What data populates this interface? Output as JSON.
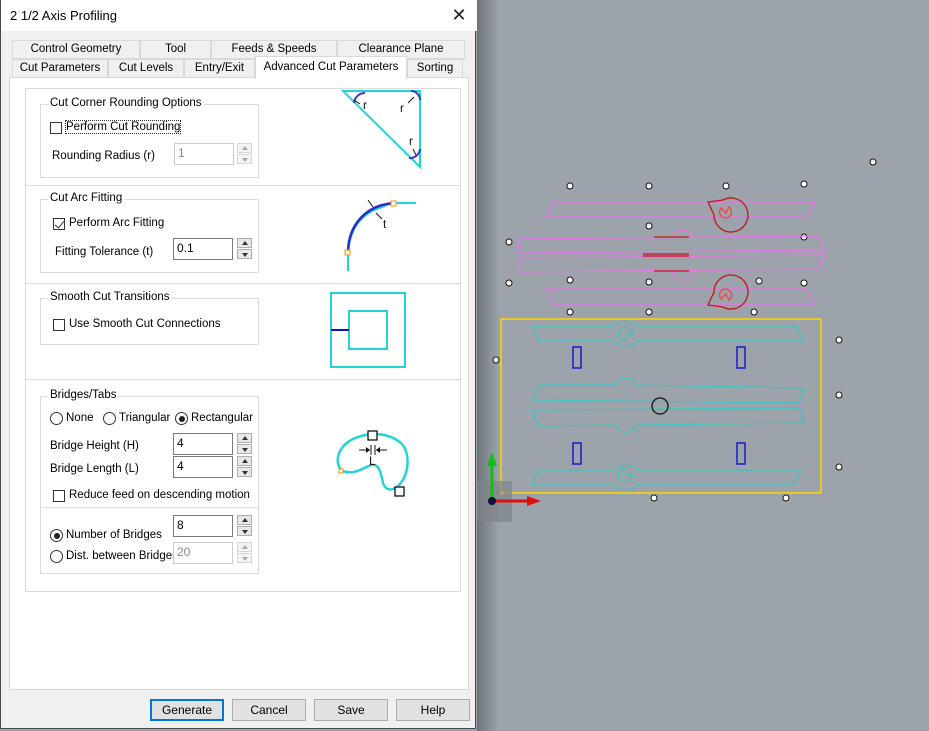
{
  "dialog": {
    "title": "2 1/2 Axis Profiling",
    "close_icon": "close-icon",
    "tabs_row1": [
      {
        "label": "Control Geometry"
      },
      {
        "label": "Tool"
      },
      {
        "label": "Feeds & Speeds"
      },
      {
        "label": "Clearance Plane"
      }
    ],
    "tabs_row2": [
      {
        "label": "Cut Parameters"
      },
      {
        "label": "Cut Levels"
      },
      {
        "label": "Entry/Exit"
      },
      {
        "label": "Advanced Cut Parameters",
        "active": true
      },
      {
        "label": "Sorting"
      }
    ],
    "corner_rounding": {
      "title": "Cut Corner Rounding Options",
      "perform_label": "Perform Cut Rounding",
      "perform_checked": false,
      "radius_label": "Rounding Radius (r)",
      "radius_value": "1",
      "radius_disabled": true,
      "illus_label": "r"
    },
    "arc_fitting": {
      "title": "Cut Arc Fitting",
      "perform_label": "Perform Arc Fitting",
      "perform_checked": true,
      "tolerance_label": "Fitting Tolerance (t)",
      "tolerance_value": "0.1",
      "illus_label": "t"
    },
    "smooth_transitions": {
      "title": "Smooth Cut Transitions",
      "use_label": "Use Smooth Cut Connections",
      "use_checked": false
    },
    "bridges": {
      "title": "Bridges/Tabs",
      "type_options": [
        "None",
        "Triangular",
        "Rectangular"
      ],
      "type_selected": "Rectangular",
      "height_label": "Bridge Height (H)",
      "height_value": "4",
      "length_label": "Bridge Length (L)",
      "length_value": "4",
      "reduce_feed_label": "Reduce feed on descending motion",
      "reduce_feed_checked": false,
      "count_mode_options": [
        "Number of Bridges",
        "Dist. between Bridges"
      ],
      "count_mode_selected": "Number of Bridges",
      "number_value": "8",
      "distance_value": "20",
      "illus_label": "L"
    },
    "buttons": {
      "generate": "Generate",
      "cancel": "Cancel",
      "save": "Save",
      "help": "Help"
    }
  },
  "viewport": {
    "background": "#9ca3aa",
    "colors": {
      "stock_box": "#ffd400",
      "toolpath_parts": "#3cc4c4",
      "bridges": "#1a1acc",
      "upper_parts": "#e676e6",
      "upper_highlight": "#c01818",
      "x_axis": "#e01010",
      "y_axis": "#10c010"
    }
  }
}
